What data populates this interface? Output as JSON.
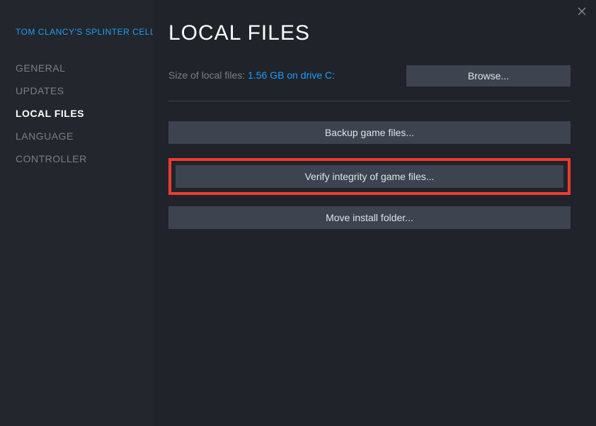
{
  "game_title": "TOM CLANCY'S SPLINTER CELL",
  "sidebar": {
    "items": [
      {
        "label": "GENERAL"
      },
      {
        "label": "UPDATES"
      },
      {
        "label": "LOCAL FILES"
      },
      {
        "label": "LANGUAGE"
      },
      {
        "label": "CONTROLLER"
      }
    ]
  },
  "main": {
    "title": "LOCAL FILES",
    "size_label": "Size of local files: ",
    "size_value": "1.56 GB on drive C:",
    "browse_label": "Browse...",
    "backup_label": "Backup game files...",
    "verify_label": "Verify integrity of game files...",
    "move_label": "Move install folder..."
  }
}
